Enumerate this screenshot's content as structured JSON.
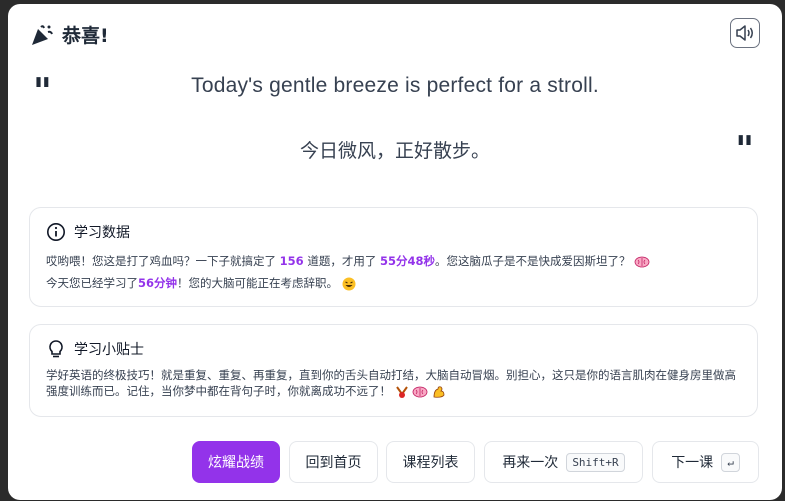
{
  "header": {
    "title": "恭喜!"
  },
  "quote": {
    "english": "Today's gentle breeze is perfect for a stroll.",
    "chinese": "今日微风，正好散步。",
    "open_mark": "\"",
    "close_mark": "\""
  },
  "stats": {
    "title": "学习数据",
    "line1_a": "哎哟喂！您这是打了鸡血吗？一下子就搞定了 ",
    "count": "156",
    "line1_b": " 道题，才用了 ",
    "time": "55分48秒",
    "line1_c": "。您这脑瓜子是不是快成爱因斯坦了？",
    "line2_a": "今天您已经学习了",
    "today_time": "56分钟",
    "line2_b": "！您的大脑可能正在考虑辞职。"
  },
  "tips": {
    "title": "学习小贴士",
    "text": "学好英语的终极技巧！就是重复、重复、再重复，直到你的舌头自动打结，大脑自动冒烟。别担心，这只是你的语言肌肉在健身房里做高强度训练而已。记住，当你梦中都在背句子时，你就离成功不远了！"
  },
  "buttons": {
    "show_off": "炫耀战绩",
    "home": "回到首页",
    "course_list": "课程列表",
    "again": "再来一次",
    "again_shortcut": "Shift+R",
    "next": "下一课",
    "next_shortcut": "↵"
  },
  "colors": {
    "accent": "#9333ea",
    "text": "#1f2937",
    "border": "#e5e7eb"
  }
}
